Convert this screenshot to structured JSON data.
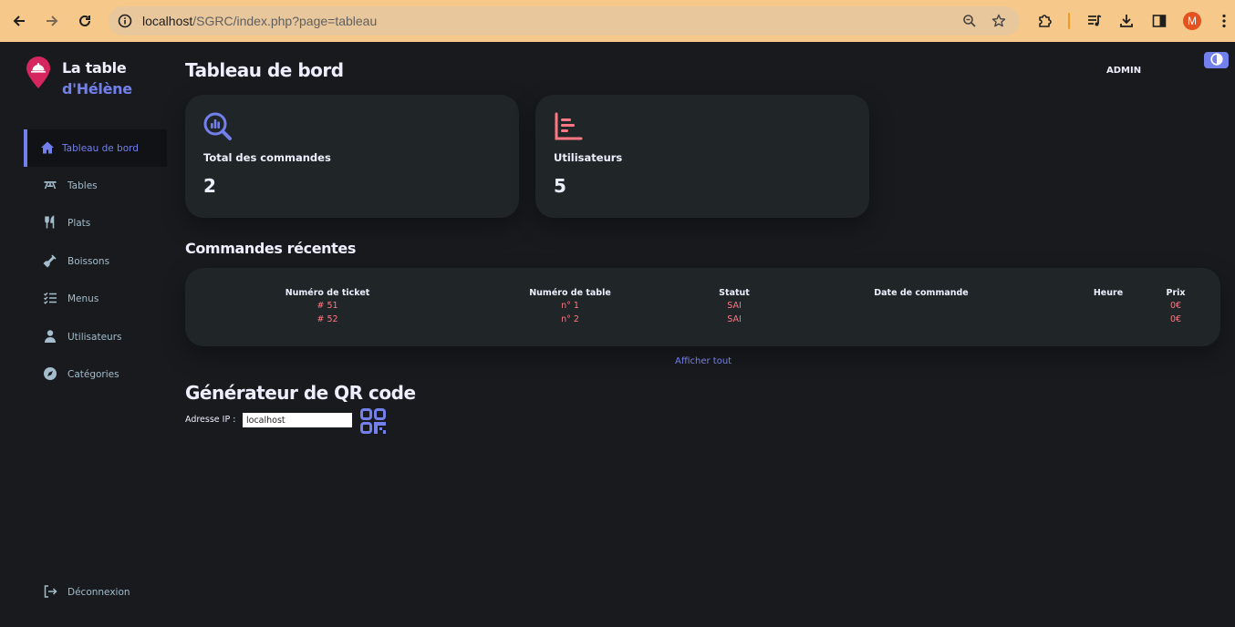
{
  "browser": {
    "url_host": "localhost",
    "url_path": "/SGRC/index.php?page=tableau",
    "profile_initial": "M",
    "accent": "#f6c98a"
  },
  "sidebar": {
    "logo_line1": "La table",
    "logo_line2": "d'Hélène",
    "items": [
      {
        "label": "Tableau de bord",
        "icon": "home-icon",
        "active": true
      },
      {
        "label": "Tables",
        "icon": "table-icon",
        "active": false
      },
      {
        "label": "Plats",
        "icon": "cutlery-icon",
        "active": false
      },
      {
        "label": "Boissons",
        "icon": "bottle-icon",
        "active": false
      },
      {
        "label": "Menus",
        "icon": "checklist-icon",
        "active": false
      },
      {
        "label": "Utilisateurs",
        "icon": "user-icon",
        "active": false
      },
      {
        "label": "Catégories",
        "icon": "compass-icon",
        "active": false
      }
    ],
    "logout_label": "Déconnexion"
  },
  "header": {
    "title": "Tableau de bord",
    "user_label": "ADMIN"
  },
  "cards": [
    {
      "label": "Total des commandes",
      "value": "2",
      "icon": "analytics-search-icon",
      "color": "#7380ec"
    },
    {
      "label": "Utilisateurs",
      "value": "5",
      "icon": "bar-list-icon",
      "color": "#ff7782"
    }
  ],
  "recent_orders": {
    "title": "Commandes récentes",
    "columns": [
      "Numéro de ticket",
      "Numéro de table",
      "Statut",
      "Date de commande",
      "Heure",
      "Prix"
    ],
    "rows": [
      {
        "ticket": "# 51",
        "table": "n° 1",
        "status": "SAI",
        "date": "",
        "time": "",
        "price": "0€"
      },
      {
        "ticket": "# 52",
        "table": "n° 2",
        "status": "SAI",
        "date": "",
        "time": "",
        "price": "0€"
      }
    ],
    "show_all_label": "Afficher tout"
  },
  "qr_generator": {
    "title": "Générateur de QR code",
    "ip_label": "Adresse IP :",
    "ip_value": "localhost"
  },
  "colors": {
    "primary": "#7380ec",
    "danger": "#ff7782",
    "background": "#181a1e",
    "card": "#202528"
  }
}
